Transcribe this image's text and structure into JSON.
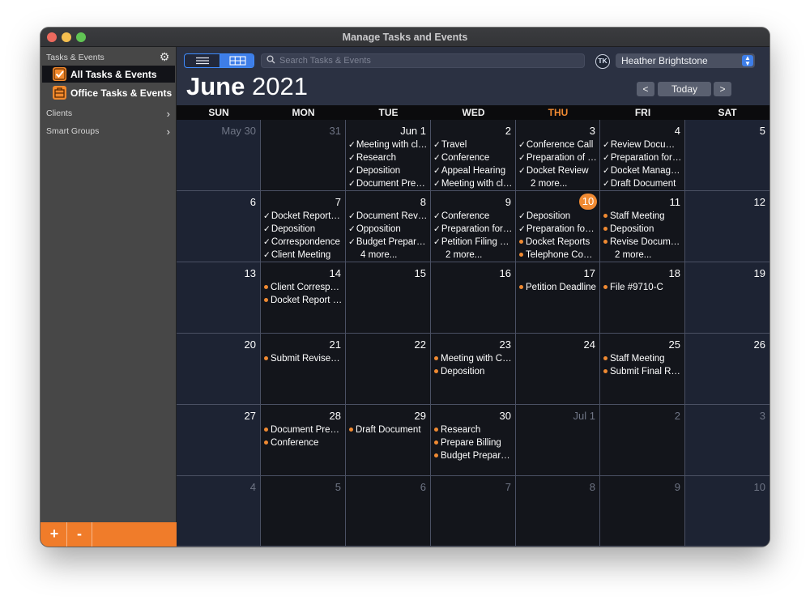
{
  "window": {
    "title": "Manage Tasks and Events"
  },
  "sidebar": {
    "header": "Tasks & Events",
    "items": [
      {
        "label": "All Tasks & Events",
        "icon": "checkbox-icon",
        "selected": true
      },
      {
        "label": "Office Tasks & Events",
        "icon": "office-icon",
        "selected": false
      }
    ],
    "groups": [
      {
        "label": "Clients"
      },
      {
        "label": "Smart Groups"
      }
    ],
    "footer": {
      "add_label": "+",
      "remove_label": "-"
    }
  },
  "toolbar": {
    "search_placeholder": "Search Tasks & Events",
    "user_badge": "TK",
    "user": "Heather Brightstone"
  },
  "header": {
    "month": "June",
    "year": "2021",
    "prev_label": "<",
    "today_label": "Today",
    "next_label": ">"
  },
  "calendar": {
    "weekdays": [
      "SUN",
      "MON",
      "TUE",
      "WED",
      "THU",
      "FRI",
      "SAT"
    ],
    "today_weekday_index": 4,
    "accent_color": "#f08a32",
    "weeks": [
      [
        {
          "day": "May 30",
          "out": true,
          "events": []
        },
        {
          "day": "31",
          "out": true,
          "events": []
        },
        {
          "day": "Jun 1",
          "events": [
            {
              "mark": "check",
              "text": "Meeting with client"
            },
            {
              "mark": "check",
              "text": "Research"
            },
            {
              "mark": "check",
              "text": "Deposition"
            },
            {
              "mark": "check",
              "text": "Document Preparation"
            }
          ]
        },
        {
          "day": "2",
          "events": [
            {
              "mark": "check",
              "text": "Travel"
            },
            {
              "mark": "check",
              "text": "Conference"
            },
            {
              "mark": "check",
              "text": "Appeal Hearing"
            },
            {
              "mark": "check",
              "text": "Meeting with client"
            }
          ]
        },
        {
          "day": "3",
          "events": [
            {
              "mark": "check",
              "text": "Conference Call"
            },
            {
              "mark": "check",
              "text": "Preparation of Documents"
            },
            {
              "mark": "check",
              "text": "Docket Review"
            },
            {
              "mark": "more",
              "text": "2 more..."
            }
          ]
        },
        {
          "day": "4",
          "events": [
            {
              "mark": "check",
              "text": "Review Documents"
            },
            {
              "mark": "check",
              "text": "Preparation for Trial"
            },
            {
              "mark": "check",
              "text": "Docket Management"
            },
            {
              "mark": "check",
              "text": "Draft Document"
            }
          ]
        },
        {
          "day": "5",
          "events": []
        }
      ],
      [
        {
          "day": "6",
          "events": []
        },
        {
          "day": "7",
          "events": [
            {
              "mark": "check",
              "text": "Docket Report Review"
            },
            {
              "mark": "check",
              "text": "Deposition"
            },
            {
              "mark": "check",
              "text": "Correspondence"
            },
            {
              "mark": "check",
              "text": "Client Meeting"
            }
          ]
        },
        {
          "day": "8",
          "events": [
            {
              "mark": "check",
              "text": "Document Review"
            },
            {
              "mark": "check",
              "text": "Opposition"
            },
            {
              "mark": "check",
              "text": "Budget Preparation"
            },
            {
              "mark": "more",
              "text": "4 more..."
            }
          ]
        },
        {
          "day": "9",
          "events": [
            {
              "mark": "check",
              "text": "Conference"
            },
            {
              "mark": "check",
              "text": "Preparation for Hearing"
            },
            {
              "mark": "check",
              "text": "Petition Filing Fee"
            },
            {
              "mark": "more",
              "text": "2 more..."
            }
          ]
        },
        {
          "day": "10",
          "today": true,
          "events": [
            {
              "mark": "check",
              "text": "Deposition"
            },
            {
              "mark": "check",
              "text": "Preparation for Trial"
            },
            {
              "mark": "dot",
              "text": "Docket Reports"
            },
            {
              "mark": "dot",
              "text": "Telephone Conference"
            }
          ]
        },
        {
          "day": "11",
          "events": [
            {
              "mark": "dot",
              "text": "Staff Meeting"
            },
            {
              "mark": "dot",
              "text": "Deposition"
            },
            {
              "mark": "dot",
              "text": "Revise Document"
            },
            {
              "mark": "more",
              "text": "2 more..."
            }
          ]
        },
        {
          "day": "12",
          "events": []
        }
      ],
      [
        {
          "day": "13",
          "events": []
        },
        {
          "day": "14",
          "events": [
            {
              "mark": "dot",
              "text": "Client Correspondence"
            },
            {
              "mark": "dot",
              "text": "Docket Report Review"
            }
          ]
        },
        {
          "day": "15",
          "events": []
        },
        {
          "day": "16",
          "events": []
        },
        {
          "day": "17",
          "events": [
            {
              "mark": "dot",
              "text": "Petition Deadline"
            }
          ]
        },
        {
          "day": "18",
          "events": [
            {
              "mark": "dot",
              "text": "File #9710-C"
            }
          ]
        },
        {
          "day": "19",
          "events": []
        }
      ],
      [
        {
          "day": "20",
          "events": []
        },
        {
          "day": "21",
          "events": [
            {
              "mark": "dot",
              "text": "Submit Revised Document"
            }
          ]
        },
        {
          "day": "22",
          "events": []
        },
        {
          "day": "23",
          "events": [
            {
              "mark": "dot",
              "text": "Meeting with Client"
            },
            {
              "mark": "dot",
              "text": "Deposition"
            }
          ]
        },
        {
          "day": "24",
          "events": []
        },
        {
          "day": "25",
          "events": [
            {
              "mark": "dot",
              "text": "Staff Meeting"
            },
            {
              "mark": "dot",
              "text": "Submit Final Report"
            }
          ]
        },
        {
          "day": "26",
          "events": []
        }
      ],
      [
        {
          "day": "27",
          "events": []
        },
        {
          "day": "28",
          "events": [
            {
              "mark": "dot",
              "text": "Document Preparation"
            },
            {
              "mark": "dot",
              "text": "Conference"
            }
          ]
        },
        {
          "day": "29",
          "events": [
            {
              "mark": "dot",
              "text": "Draft Document"
            }
          ]
        },
        {
          "day": "30",
          "events": [
            {
              "mark": "dot",
              "text": "Research"
            },
            {
              "mark": "dot",
              "text": "Prepare Billing"
            },
            {
              "mark": "dot",
              "text": "Budget Preparation"
            }
          ]
        },
        {
          "day": "Jul 1",
          "out": true,
          "events": []
        },
        {
          "day": "2",
          "out": true,
          "events": []
        },
        {
          "day": "3",
          "out": true,
          "events": []
        }
      ],
      [
        {
          "day": "4",
          "out": true,
          "events": []
        },
        {
          "day": "5",
          "out": true,
          "events": []
        },
        {
          "day": "6",
          "out": true,
          "events": []
        },
        {
          "day": "7",
          "out": true,
          "events": []
        },
        {
          "day": "8",
          "out": true,
          "events": []
        },
        {
          "day": "9",
          "out": true,
          "events": []
        },
        {
          "day": "10",
          "out": true,
          "events": []
        }
      ]
    ]
  }
}
